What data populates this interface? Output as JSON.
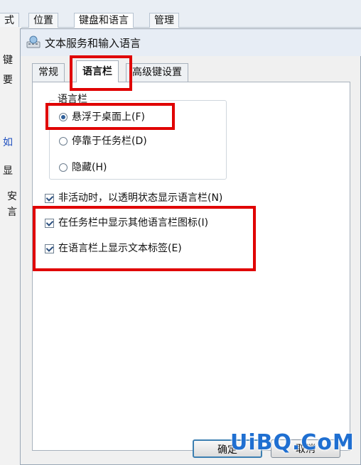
{
  "background": {
    "tabs": [
      "式",
      "位置",
      "键盘和语言",
      "管理"
    ],
    "left_text": [
      "键",
      "要",
      "如",
      "显",
      "安",
      "言"
    ]
  },
  "dialog": {
    "title": "文本服务和输入语言",
    "tabs": [
      {
        "label": "常规",
        "active": false
      },
      {
        "label": "语言栏",
        "active": true
      },
      {
        "label": "高级键设置",
        "active": false
      }
    ],
    "group_title": "语言栏",
    "radios": [
      {
        "label": "悬浮于桌面上(F)",
        "checked": true
      },
      {
        "label": "停靠于任务栏(D)",
        "checked": false
      },
      {
        "label": "隐藏(H)",
        "checked": false
      }
    ],
    "checkboxes": [
      {
        "label": "非活动时，以透明状态显示语言栏(N)",
        "checked": true
      },
      {
        "label": "在任务栏中显示其他语言栏图标(I)",
        "checked": true
      },
      {
        "label": "在语言栏上显示文本标签(E)",
        "checked": true
      }
    ],
    "buttons": {
      "ok": "确定",
      "cancel": "取消"
    }
  },
  "watermark": "UiBQ.CoM",
  "colors": {
    "highlight": "#e00000",
    "accent": "#3c7fb1"
  }
}
